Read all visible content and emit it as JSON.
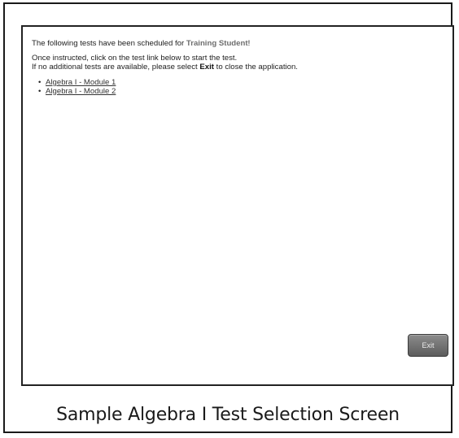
{
  "intro": {
    "prefix": "The following tests have been scheduled for ",
    "student_name": "Training Student",
    "suffix": "!"
  },
  "instructions": {
    "line1": "Once instructed, click on the test link below to start the test.",
    "line2_prefix": "If no additional tests are available, please select ",
    "line2_bold": "Exit",
    "line2_suffix": " to close the application."
  },
  "tests": [
    {
      "label": "Algebra I - Module 1"
    },
    {
      "label": "Algebra I - Module 2"
    }
  ],
  "exit_button": {
    "label": "Exit"
  },
  "caption": "Sample Algebra I Test Selection Screen",
  "colors": {
    "student_name": "#6e6e6e",
    "exit_button_bg": "#6f6f6f",
    "frame_border": "#1a1a1a"
  }
}
